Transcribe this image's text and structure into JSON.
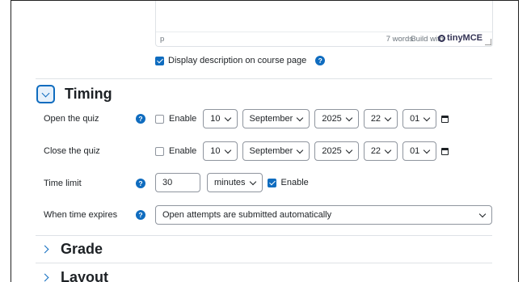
{
  "editor": {
    "path": "p",
    "word_count": "7 words",
    "build_with": "Build with",
    "brand": "tinyMCE"
  },
  "display_description": {
    "label": "Display description on course page",
    "checked": true
  },
  "timing": {
    "title": "Timing",
    "open": {
      "label": "Open the quiz",
      "enable_label": "Enable",
      "day": "10",
      "month": "September",
      "year": "2025",
      "hour": "22",
      "minute": "01"
    },
    "close": {
      "label": "Close the quiz",
      "enable_label": "Enable",
      "day": "10",
      "month": "September",
      "year": "2025",
      "hour": "22",
      "minute": "01"
    },
    "time_limit": {
      "label": "Time limit",
      "value": "30",
      "unit": "minutes",
      "enable_label": "Enable"
    },
    "when_expires": {
      "label": "When time expires",
      "value": "Open attempts are submitted automatically"
    }
  },
  "sections": {
    "grade": "Grade",
    "layout": "Layout"
  },
  "colors": {
    "accent": "#0f6cbf"
  }
}
